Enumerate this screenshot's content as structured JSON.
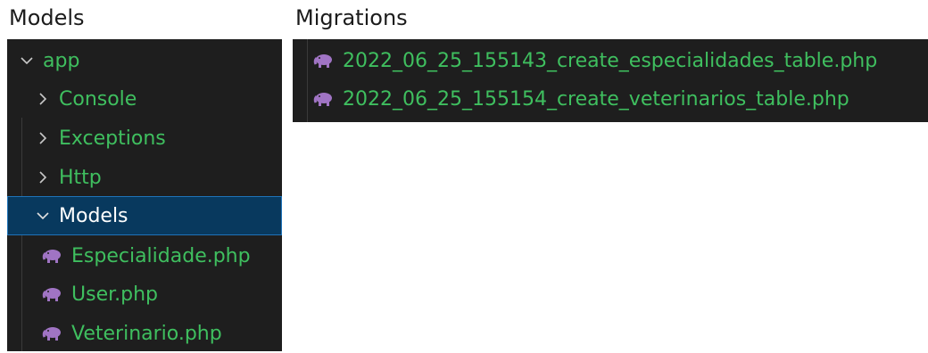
{
  "models_title": "Models",
  "migrations_title": "Migrations",
  "explorer": {
    "root": {
      "label": "app",
      "state": "expanded"
    },
    "folders": [
      {
        "label": "Console",
        "state": "collapsed"
      },
      {
        "label": "Exceptions",
        "state": "collapsed"
      },
      {
        "label": "Http",
        "state": "collapsed"
      },
      {
        "label": "Models",
        "state": "expanded",
        "selected": true
      }
    ],
    "files": [
      {
        "label": "Especialidade.php",
        "icon": "php-elephant-icon"
      },
      {
        "label": "User.php",
        "icon": "php-elephant-icon"
      },
      {
        "label": "Veterinario.php",
        "icon": "php-elephant-icon"
      }
    ]
  },
  "migrations": {
    "files": [
      {
        "label": "2022_06_25_155143_create_especialidades_table.php",
        "icon": "php-elephant-icon"
      },
      {
        "label": "2022_06_25_155154_create_veterinarios_table.php",
        "icon": "php-elephant-icon"
      }
    ]
  },
  "colors": {
    "panel_bg": "#1e1e1e",
    "file_text": "#3fbf5f",
    "selected_bg": "#08395e",
    "selected_border": "#1f73b8",
    "php_icon": "#a074c4"
  }
}
